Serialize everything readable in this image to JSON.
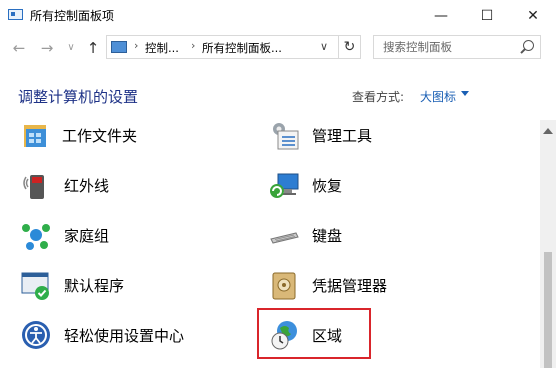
{
  "window": {
    "title": "所有控制面板项",
    "minimize_glyph": "—",
    "maximize_glyph": "☐",
    "close_glyph": "✕"
  },
  "nav": {
    "back_glyph": "←",
    "forward_glyph": "→",
    "dropdown_glyph": "∨",
    "up_glyph": "↑",
    "refresh_glyph": "↻"
  },
  "address": {
    "crumbs": [
      "控制...",
      "所有控制面板..."
    ],
    "separator": "›",
    "dropdown_glyph": "∨"
  },
  "search": {
    "placeholder": "搜索控制面板"
  },
  "page": {
    "heading": "调整计算机的设置",
    "view_label": "查看方式:",
    "view_value": "大图标"
  },
  "items": [
    {
      "label": "工作文件夹",
      "icon": "work-folders-icon"
    },
    {
      "label": "管理工具",
      "icon": "admin-tools-icon"
    },
    {
      "label": "红外线",
      "icon": "infrared-icon"
    },
    {
      "label": "恢复",
      "icon": "recovery-icon"
    },
    {
      "label": "家庭组",
      "icon": "homegroup-icon"
    },
    {
      "label": "键盘",
      "icon": "keyboard-icon"
    },
    {
      "label": "默认程序",
      "icon": "default-programs-icon"
    },
    {
      "label": "凭据管理器",
      "icon": "credential-manager-icon"
    },
    {
      "label": "轻松使用设置中心",
      "icon": "ease-of-access-icon"
    },
    {
      "label": "区域",
      "icon": "region-icon"
    }
  ],
  "highlighted_item": "区域",
  "colors": {
    "heading": "#1e3287",
    "link": "#1a5fb4",
    "highlight_border": "#d9252b"
  }
}
